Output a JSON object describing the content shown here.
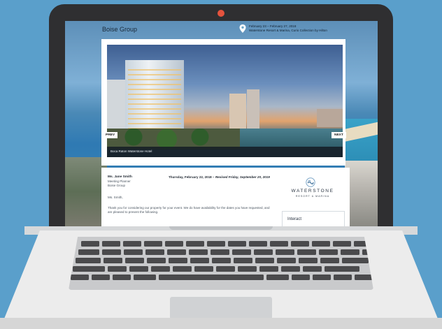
{
  "header": {
    "brand": "Boise Group",
    "event_dates": "February 23 – February 27, 2018",
    "venue": "Waterstone Resort & Marina, Curio Collection by Hilton"
  },
  "gallery": {
    "caption": "Boca Raton Waterstone Hotel",
    "prev_label": "PREV",
    "next_label": "NEXT"
  },
  "letter": {
    "contact_name": "Ms. Jane Smith",
    "contact_title": "Meeting Planner",
    "contact_org": "Boise Group",
    "date": "Thursday, February 22, 2018",
    "revised": "Revised Friday, September 20, 2019",
    "salutation": "Ms. Smith,",
    "body": "Thank you for considering our property for your event. We do have availability for the dates you have requested, and are pleased to present the following."
  },
  "sidebar": {
    "logo_word": "WATERSTONE",
    "logo_sub": "RESORT & MARINA",
    "interact_label": "Interact"
  },
  "icons": {
    "pin": "map-pin-icon",
    "logo": "waterstone-logo-icon"
  },
  "colors": {
    "laptop_frame": "#2f2f31",
    "camera": "#e5533d",
    "background": "#5a9fcb"
  }
}
